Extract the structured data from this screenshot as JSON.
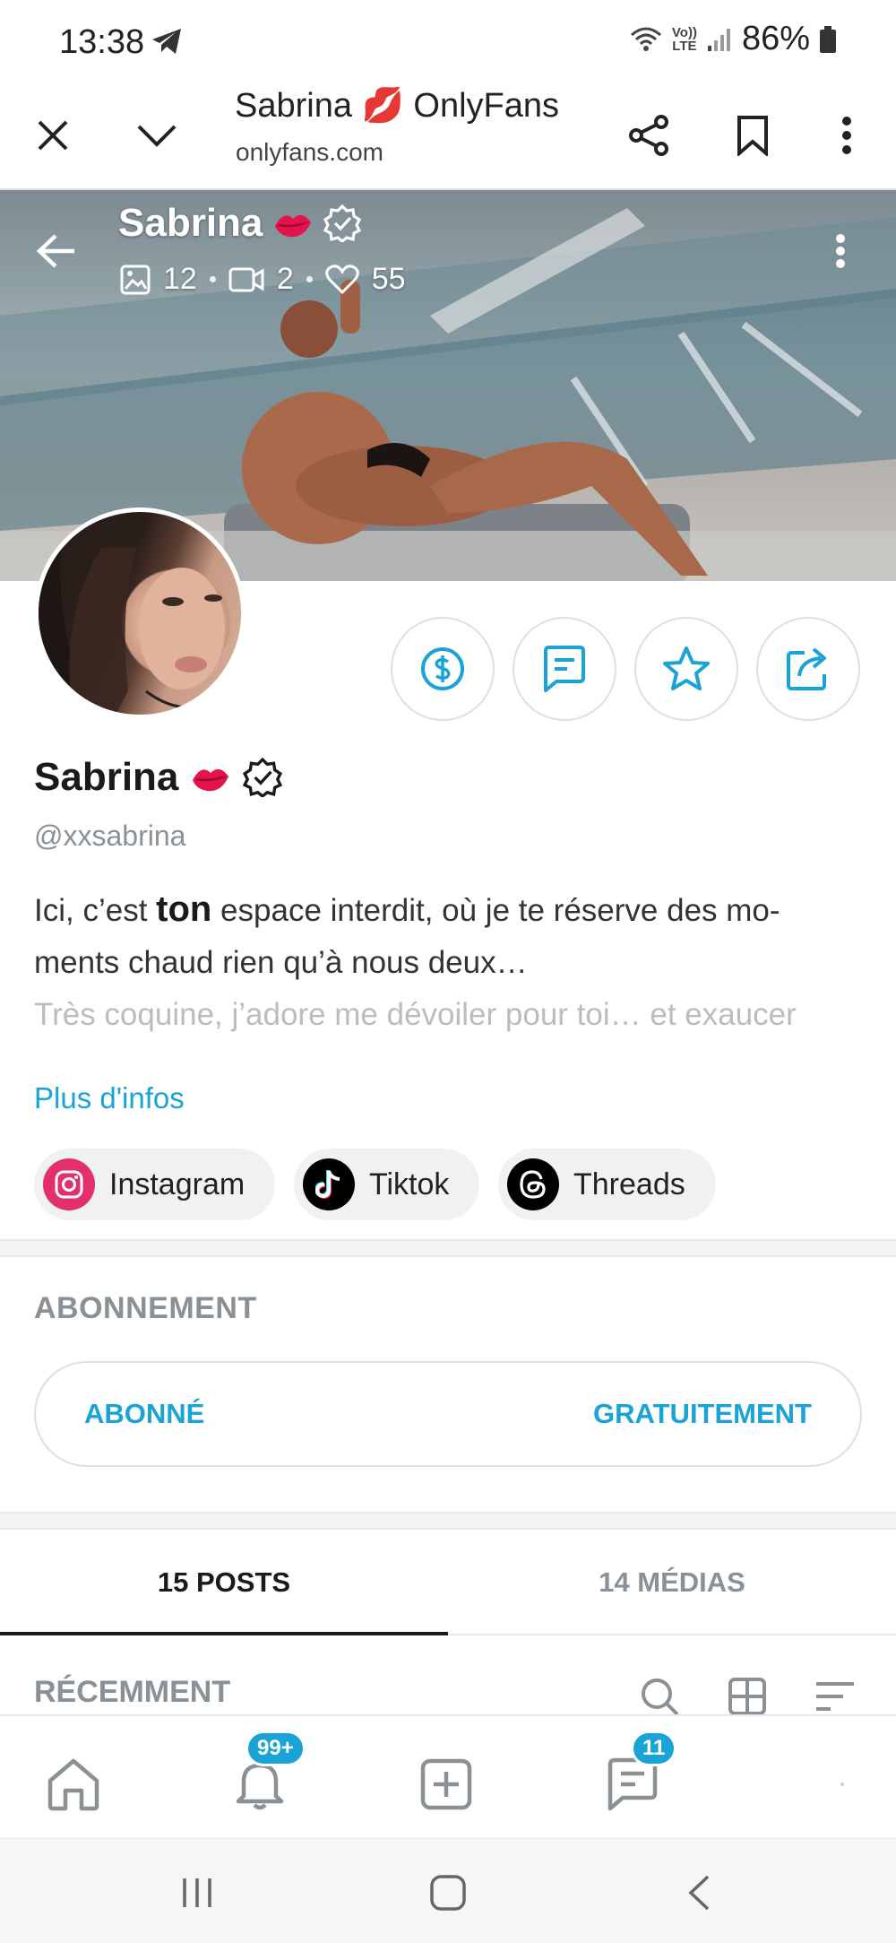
{
  "status_bar": {
    "time": "13:38",
    "volte": "Vo))",
    "lte": "LTE",
    "battery": "86%"
  },
  "browser": {
    "title": "Sabrina 💋 OnlyFans",
    "url": "onlyfans.com"
  },
  "cover": {
    "name": "Sabrina",
    "photos": "12",
    "videos": "2",
    "likes": "55"
  },
  "profile": {
    "name": "Sabrina",
    "handle": "@xxsabrina",
    "bio_line1_pre": "Ici, c’est ",
    "bio_line1_bold": "ton",
    "bio_line1_post": " espace interdit, où je te réserve des mo-",
    "bio_line2": "ments chaud rien qu’à nous deux…",
    "bio_line3": "Très coquine, j’adore me dévoiler pour toi… et exaucer",
    "more": "Plus d'infos"
  },
  "socials": [
    {
      "label": "Instagram",
      "icon": "instagram-icon",
      "color": "#e1306c"
    },
    {
      "label": "Tiktok",
      "icon": "tiktok-icon",
      "color": "#000000"
    },
    {
      "label": "Threads",
      "icon": "threads-icon",
      "color": "#000000"
    }
  ],
  "subscription": {
    "title": "ABONNEMENT",
    "status": "ABONNÉ",
    "price": "GRATUITEMENT"
  },
  "tabs": {
    "posts": "15 POSTS",
    "media": "14 MÉDIAS"
  },
  "recent": {
    "label": "RÉCEMMENT"
  },
  "app_nav": {
    "notifications_badge": "99+",
    "messages_badge": "11"
  },
  "colors": {
    "accent": "#1aa3d6",
    "text": "#1a1a1a",
    "muted": "#8a9196"
  }
}
